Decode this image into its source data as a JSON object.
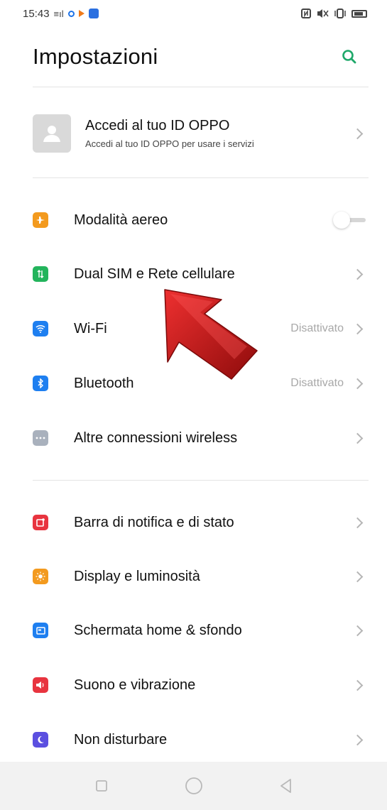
{
  "status_bar": {
    "time": "15:43",
    "signal": "≡ıl",
    "right_icons": [
      "nfc-icon",
      "mute-icon",
      "vibrate-icon",
      "battery-icon"
    ]
  },
  "header": {
    "title": "Impostazioni",
    "search_icon": "search-icon",
    "accent_color": "#1fa86a"
  },
  "account": {
    "title": "Accedi al tuo ID OPPO",
    "subtitle": "Accedi al tuo ID OPPO per usare i servizi"
  },
  "connectivity": [
    {
      "label": "Modalità aereo",
      "icon": "airplane-icon",
      "color": "#f39a1e",
      "control": "toggle",
      "toggle_on": false
    },
    {
      "label": "Dual SIM e Rete cellulare",
      "icon": "sim-icon",
      "color": "#23b45c",
      "control": "chevron"
    },
    {
      "label": "Wi-Fi",
      "icon": "wifi-icon",
      "color": "#1e7ff0",
      "control": "chevron",
      "value": "Disattivato"
    },
    {
      "label": "Bluetooth",
      "icon": "bluetooth-icon",
      "color": "#1e7ff0",
      "control": "chevron",
      "value": "Disattivato"
    },
    {
      "label": "Altre connessioni wireless",
      "icon": "more-connections-icon",
      "color": "#a9b1bd",
      "control": "chevron"
    }
  ],
  "system": [
    {
      "label": "Barra di notifica e di stato",
      "icon": "notification-icon",
      "color": "#e8343f",
      "control": "chevron"
    },
    {
      "label": "Display e luminosità",
      "icon": "brightness-icon",
      "color": "#f39a1e",
      "control": "chevron"
    },
    {
      "label": "Schermata home & sfondo",
      "icon": "wallpaper-icon",
      "color": "#1e7ff0",
      "control": "chevron"
    },
    {
      "label": "Suono e vibrazione",
      "icon": "sound-icon",
      "color": "#e8343f",
      "control": "chevron"
    },
    {
      "label": "Non disturbare",
      "icon": "moon-icon",
      "color": "#5b4fe0",
      "control": "chevron"
    }
  ],
  "nav_bar": {
    "buttons": [
      "recent-apps-icon",
      "home-icon",
      "back-icon"
    ]
  },
  "annotation": {
    "arrow_color": "#cc1111"
  }
}
